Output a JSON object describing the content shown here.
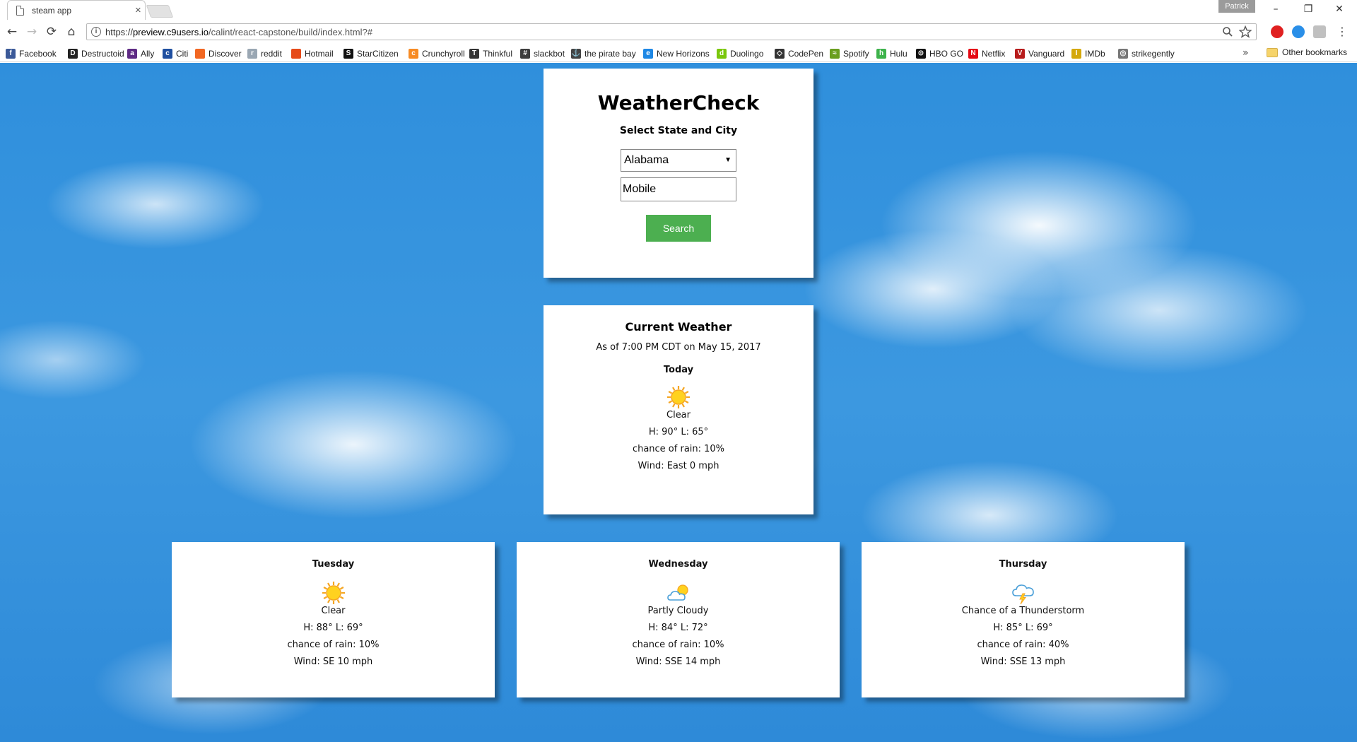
{
  "browser": {
    "tab_title": "steam app",
    "tab_close": "×",
    "profile_name": "Patrick",
    "url_scheme": "https://",
    "url_host": "preview.c9users.io",
    "url_path": "/calint/react-capstone/build/index.html?#",
    "window": {
      "minimize": "–",
      "restore": "❐",
      "close": "✕"
    },
    "nav": {
      "back": "←",
      "forward": "→",
      "reload": "⟳",
      "home": "⌂"
    },
    "bookmarks": [
      {
        "label": "Facebook",
        "icon": "facebook-icon",
        "color": "#3b5998",
        "glyph": "f"
      },
      {
        "label": "Destructoid",
        "icon": "destructoid-icon",
        "color": "#222222",
        "glyph": "D"
      },
      {
        "label": "Ally",
        "icon": "ally-icon",
        "color": "#5e2a84",
        "glyph": "a"
      },
      {
        "label": "Citi",
        "icon": "citi-icon",
        "color": "#1f4fa0",
        "glyph": "c"
      },
      {
        "label": "Discover",
        "icon": "discover-icon",
        "color": "#f26722",
        "glyph": ""
      },
      {
        "label": "reddit",
        "icon": "reddit-icon",
        "color": "#9aa7b3",
        "glyph": "r"
      },
      {
        "label": "Hotmail",
        "icon": "hotmail-icon",
        "color": "#e64a19",
        "glyph": ""
      },
      {
        "label": "StarCitizen",
        "icon": "starcitizen-icon",
        "color": "#111111",
        "glyph": "S"
      },
      {
        "label": "Crunchyroll",
        "icon": "crunchyroll-icon",
        "color": "#f78b24",
        "glyph": "c"
      },
      {
        "label": "Thinkful",
        "icon": "thinkful-icon",
        "color": "#333333",
        "glyph": "T"
      },
      {
        "label": "slackbot",
        "icon": "slackbot-icon",
        "color": "#3d3d3d",
        "glyph": "#"
      },
      {
        "label": "the pirate bay",
        "icon": "piratebay-icon",
        "color": "#444444",
        "glyph": "⚓"
      },
      {
        "label": "New Horizons",
        "icon": "newhorizons-icon",
        "color": "#1e88e5",
        "glyph": "e"
      },
      {
        "label": "Duolingo",
        "icon": "duolingo-icon",
        "color": "#7ac70c",
        "glyph": "d"
      },
      {
        "label": "CodePen",
        "icon": "codepen-icon",
        "color": "#333333",
        "glyph": "◇"
      },
      {
        "label": "Spotify",
        "icon": "spotify-icon",
        "color": "#6a9e1f",
        "glyph": "≈"
      },
      {
        "label": "Hulu",
        "icon": "hulu-icon",
        "color": "#3db24b",
        "glyph": "h"
      },
      {
        "label": "HBO GO",
        "icon": "hbogo-icon",
        "color": "#111111",
        "glyph": "⊙"
      },
      {
        "label": "Netflix",
        "icon": "netflix-icon",
        "color": "#e50914",
        "glyph": "N"
      },
      {
        "label": "Vanguard",
        "icon": "vanguard-icon",
        "color": "#b71c1c",
        "glyph": "V"
      },
      {
        "label": "IMDb",
        "icon": "imdb-icon",
        "color": "#d4a80b",
        "glyph": "I"
      },
      {
        "label": "strikegently",
        "icon": "strikegently-icon",
        "color": "#777777",
        "glyph": "◎"
      }
    ],
    "more_bookmarks": "»",
    "other_bookmarks": "Other bookmarks"
  },
  "app": {
    "title": "WeatherCheck",
    "select_label": "Select State and City",
    "state_selected": "Alabama",
    "city_value": "Mobile",
    "search_label": "Search"
  },
  "current": {
    "title": "Current Weather",
    "as_of": "As of 7:00 PM CDT on May 15, 2017",
    "day": "Today",
    "icon": "sun-icon",
    "condition": "Clear",
    "high_low": "H: 90° L: 65°",
    "rain": "chance of rain: 10%",
    "wind": "Wind: East 0 mph"
  },
  "forecast": [
    {
      "day": "Tuesday",
      "icon": "sun-icon",
      "condition": "Clear",
      "high_low": "H: 88° L: 69°",
      "rain": "chance of rain: 10%",
      "wind": "Wind: SE 10 mph"
    },
    {
      "day": "Wednesday",
      "icon": "partly-cloudy-icon",
      "condition": "Partly Cloudy",
      "high_low": "H: 84° L: 72°",
      "rain": "chance of rain: 10%",
      "wind": "Wind: SSE 14 mph"
    },
    {
      "day": "Thursday",
      "icon": "thunderstorm-icon",
      "condition": "Chance of a Thunderstorm",
      "high_low": "H: 85° L: 69°",
      "rain": "chance of rain: 40%",
      "wind": "Wind: SSE 13 mph"
    }
  ],
  "colors": {
    "search_button": "#4caf50",
    "sky": "#3c98e0"
  }
}
